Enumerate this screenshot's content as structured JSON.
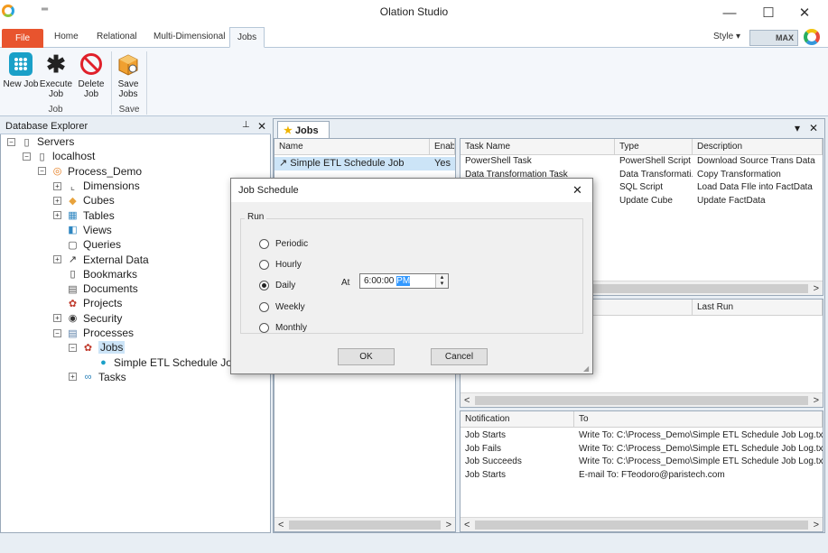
{
  "app": {
    "title": "Olation Studio",
    "qa_icon": "quick-access-chevron"
  },
  "window_controls": {
    "minimize": "—",
    "maximize": "☐",
    "close": "✕"
  },
  "ribbon_tabs": [
    "File",
    "Home",
    "Relational",
    "Multi-Dimensional",
    "Jobs"
  ],
  "style": {
    "label": "Style",
    "arrow": "▾",
    "max_label": "MAX"
  },
  "ribbon": {
    "job_group": "Job",
    "save_group": "Save",
    "new_job": "New Job",
    "execute_job": "Execute Job",
    "delete_job": "Delete Job",
    "save_jobs": "Save Jobs"
  },
  "explorer": {
    "title": "Database Explorer",
    "pin": "📌",
    "close": "✕",
    "tree": [
      {
        "label": "Servers",
        "exp": "−",
        "indent": 0
      },
      {
        "label": "localhost",
        "exp": "−",
        "indent": 1
      },
      {
        "label": "Process_Demo",
        "exp": "−",
        "indent": 2
      },
      {
        "label": "Dimensions",
        "exp": "+",
        "indent": 3
      },
      {
        "label": "Cubes",
        "exp": "+",
        "indent": 3
      },
      {
        "label": "Tables",
        "exp": "+",
        "indent": 3
      },
      {
        "label": "Views",
        "exp": "",
        "indent": 3
      },
      {
        "label": "Queries",
        "exp": "",
        "indent": 3
      },
      {
        "label": "External Data",
        "exp": "+",
        "indent": 3
      },
      {
        "label": "Bookmarks",
        "exp": "",
        "indent": 3
      },
      {
        "label": "Documents",
        "exp": "",
        "indent": 3
      },
      {
        "label": "Projects",
        "exp": "",
        "indent": 3
      },
      {
        "label": "Security",
        "exp": "+",
        "indent": 3
      },
      {
        "label": "Processes",
        "exp": "−",
        "indent": 3
      },
      {
        "label": "Jobs",
        "exp": "−",
        "indent": 4
      },
      {
        "label": "Simple ETL Schedule  Job",
        "exp": "",
        "indent": 5
      },
      {
        "label": "Tasks",
        "exp": "+",
        "indent": 4
      }
    ]
  },
  "doc_tab": {
    "label": "Jobs",
    "menu_arrow": "▾",
    "close": "✕"
  },
  "jobs_grid": {
    "columns": [
      "Name",
      "Enabl"
    ],
    "rows": [
      {
        "name": "Simple ETL Schedule  Job",
        "enabled": "Yes"
      }
    ]
  },
  "tasks_grid": {
    "columns": [
      "Task Name",
      "Type",
      "Description"
    ],
    "rows": [
      {
        "name": "PowerShell Task",
        "type": "PowerShell Script",
        "desc": "Download Source Trans Data"
      },
      {
        "name": "Data Transformation Task",
        "type": "Data Transformati...",
        "desc": "Copy Transformation"
      },
      {
        "name": "",
        "type": "SQL Script",
        "desc": "Load Data FIle into FactData"
      },
      {
        "name": "",
        "type": "Update Cube",
        "desc": "Update FactData"
      }
    ]
  },
  "history_grid": {
    "columns": [
      "",
      "Last Run"
    ]
  },
  "notify_grid": {
    "columns": [
      "Notification",
      "To"
    ],
    "rows": [
      {
        "event": "Job Starts",
        "to": "Write To: C:\\Process_Demo\\Simple ETL Schedule  Job Log.txt"
      },
      {
        "event": "Job Fails",
        "to": "Write To: C:\\Process_Demo\\Simple ETL Schedule  Job Log.txt"
      },
      {
        "event": "Job Succeeds",
        "to": "Write To: C:\\Process_Demo\\Simple ETL Schedule  Job Log.txt"
      },
      {
        "event": "Job Starts",
        "to": "E-mail To: FTeodoro@paristech.com"
      }
    ]
  },
  "scroll": {
    "left": "<",
    "right": ">"
  },
  "dialog": {
    "title": "Job Schedule",
    "close": "✕",
    "group_label": "Run",
    "options": [
      "Periodic",
      "Hourly",
      "Daily",
      "Weekly",
      "Monthly"
    ],
    "selected": "Daily",
    "at_label": "At",
    "time_value": "6:00:00 ",
    "time_ampm": "PM",
    "spin_up": "▴",
    "spin_down": "▾",
    "ok": "OK",
    "cancel": "Cancel"
  },
  "colors": {
    "accent": "#e8542e",
    "selection": "#cce4f7",
    "panel_border": "#9aa9b9"
  }
}
